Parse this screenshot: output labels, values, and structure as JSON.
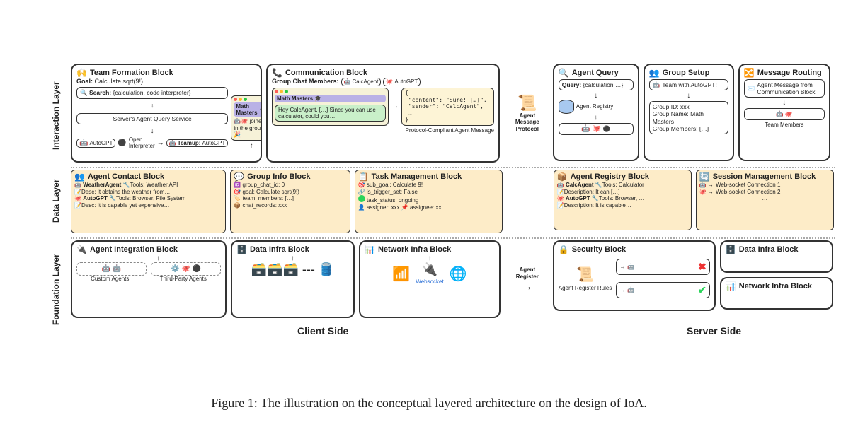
{
  "caption": "Figure 1: The illustration on the conceptual layered architecture on the design of IoA.",
  "layers": {
    "interaction": "Interaction Layer",
    "data": "Data Layer",
    "foundation": "Foundation Layer"
  },
  "side_labels": {
    "client": "Client Side",
    "server": "Server Side"
  },
  "mid_labels": {
    "agent_message_protocol": "Agent Message Protocol",
    "agent_register": "Agent Register"
  },
  "team_formation": {
    "title": "Team Formation Block",
    "goal_label": "Goal:",
    "goal": "Calculate sqrt(9!)",
    "search_label": "Search:",
    "search": "{calculation, code interpreter}",
    "server_query": "Server's Agent Query Service",
    "autogpt": "AutoGPT",
    "open_interpreter": "Open Interpreter",
    "teamup_label": "Teamup:",
    "teamup_value": "AutoGPT",
    "chat_title": "Math Masters",
    "joined_msg": "joined in the group 🎉"
  },
  "communication": {
    "title": "Communication Block",
    "members_label": "Group Chat Members:",
    "member1": "CalcAgent",
    "member2": "AutoGPT",
    "chat_title": "Math Masters 🎓",
    "bubble": "Hey CalcAgent, […] Since you can use calculator, could you…",
    "json_content": "\"content\": \"Sure! […]\",",
    "json_sender": "\"sender\": \"CalcAgent\",",
    "protocol_note": "Protocol-Compliant Agent Message"
  },
  "agent_query": {
    "title": "Agent Query",
    "query_label": "Query:",
    "query": "{calculation …}",
    "registry": "Agent Registry"
  },
  "group_setup": {
    "title": "Group Setup",
    "team_with": "Team with AutoGPT!",
    "group_id": "Group ID: xxx",
    "group_name": "Group Name: Math Masters",
    "group_members": "Group Members: […]"
  },
  "message_routing": {
    "title": "Message Routing",
    "msg_from": "Agent Message from Communication Block",
    "team_members": "Team Members"
  },
  "agent_contact": {
    "title": "Agent Contact Block",
    "row1_name": "WeatherAgent",
    "row1_tools": "Tools: Weather API",
    "row1_desc": "Desc: It obtains the weather from…",
    "row2_name": "AutoGPT",
    "row2_tools": "Tools: Browser, File System",
    "row2_desc": "Desc: It is capable yet expensive…"
  },
  "group_info": {
    "title": "Group Info Block",
    "id": "group_chat_id: 0",
    "goal": "goal: Calculate sqrt(9!)",
    "members": "team_members: […]",
    "records": "chat_records: xxx"
  },
  "task_mgmt": {
    "title": "Task Management Block",
    "subgoal": "sub_goal: Calculate 9!",
    "trigger": "is_trigger_set: False",
    "status": "task_status: ongoing",
    "assigner": "assigner: xxx",
    "assignee": "assignee: xx"
  },
  "agent_registry": {
    "title": "Agent Registry Block",
    "row1_name": "CalcAgent",
    "row1_tools": "Tools: Calculator",
    "row1_desc": "Description: It can […]",
    "row2_name": "AutoGPT",
    "row2_tools": "Tools: Browser, …",
    "row2_desc": "Description: It is capable…"
  },
  "session_mgmt": {
    "title": "Session Management Block",
    "conn1": "Web-socket Connection 1",
    "conn2": "Web-socket Connection 2"
  },
  "agent_integration": {
    "title": "Agent Integration Block",
    "custom": "Custom Agents",
    "third_party": "Third-Party Agents"
  },
  "data_infra": {
    "title": "Data Infra Block"
  },
  "network_infra": {
    "title": "Network Infra Block",
    "websocket": "Websocket"
  },
  "security": {
    "title": "Security Block",
    "rules": "Agent Register Rules"
  },
  "server_data_infra": {
    "title": "Data Infra Block"
  },
  "server_network_infra": {
    "title": "Network Infra Block"
  }
}
